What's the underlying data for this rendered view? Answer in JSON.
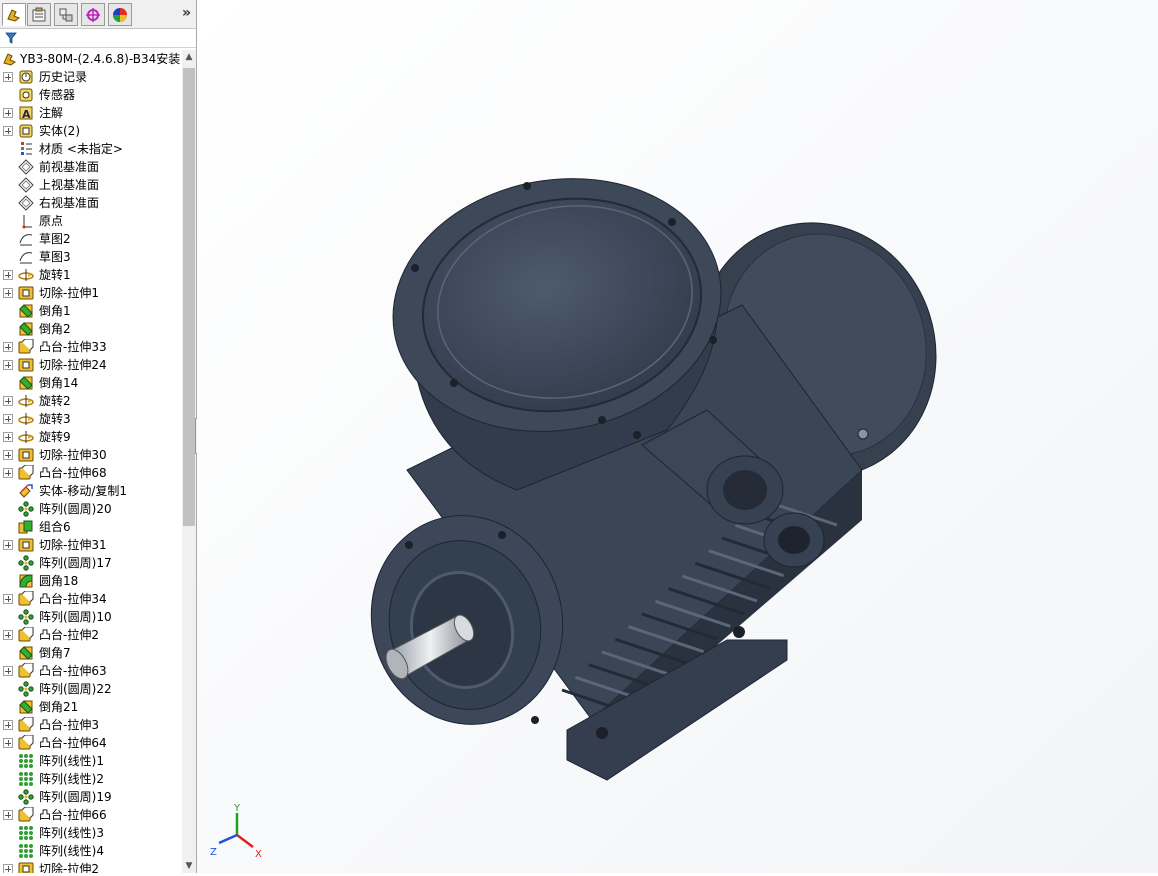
{
  "tabs": [
    {
      "name": "feature-manager",
      "active": true
    },
    {
      "name": "property-manager",
      "active": false
    },
    {
      "name": "configuration-manager",
      "active": false
    },
    {
      "name": "dimxpert-manager",
      "active": false
    },
    {
      "name": "display-manager",
      "active": false
    }
  ],
  "more_symbol": "»",
  "tree": {
    "root": "YB3-80M-(2.4.6.8)-B34安装",
    "items": [
      {
        "label": "历史记录",
        "icon": "history",
        "exp": true
      },
      {
        "label": "传感器",
        "icon": "sensor",
        "exp": false
      },
      {
        "label": "注解",
        "icon": "annotation",
        "exp": true
      },
      {
        "label": "实体(2)",
        "icon": "solid-bodies",
        "exp": true
      },
      {
        "label": "材质 <未指定>",
        "icon": "material",
        "exp": false
      },
      {
        "label": "前视基准面",
        "icon": "plane",
        "exp": false
      },
      {
        "label": "上视基准面",
        "icon": "plane",
        "exp": false
      },
      {
        "label": "右视基准面",
        "icon": "plane",
        "exp": false
      },
      {
        "label": "原点",
        "icon": "origin",
        "exp": false
      },
      {
        "label": "草图2",
        "icon": "sketch",
        "exp": false
      },
      {
        "label": "草图3",
        "icon": "sketch",
        "exp": false
      },
      {
        "label": "旋转1",
        "icon": "revolve",
        "exp": true
      },
      {
        "label": "切除-拉伸1",
        "icon": "cut-extrude",
        "exp": true
      },
      {
        "label": "倒角1",
        "icon": "chamfer",
        "exp": false
      },
      {
        "label": "倒角2",
        "icon": "chamfer",
        "exp": false
      },
      {
        "label": "凸台-拉伸33",
        "icon": "boss-extrude",
        "exp": true
      },
      {
        "label": "切除-拉伸24",
        "icon": "cut-extrude",
        "exp": true
      },
      {
        "label": "倒角14",
        "icon": "chamfer",
        "exp": false
      },
      {
        "label": "旋转2",
        "icon": "revolve",
        "exp": true
      },
      {
        "label": "旋转3",
        "icon": "revolve",
        "exp": true
      },
      {
        "label": "旋转9",
        "icon": "revolve",
        "exp": true
      },
      {
        "label": "切除-拉伸30",
        "icon": "cut-extrude",
        "exp": true
      },
      {
        "label": "凸台-拉伸68",
        "icon": "boss-extrude",
        "exp": true
      },
      {
        "label": "实体-移动/复制1",
        "icon": "move-copy",
        "exp": false
      },
      {
        "label": "阵列(圆周)20",
        "icon": "circular-pattern",
        "exp": false
      },
      {
        "label": "组合6",
        "icon": "combine",
        "exp": false
      },
      {
        "label": "切除-拉伸31",
        "icon": "cut-extrude",
        "exp": true
      },
      {
        "label": "阵列(圆周)17",
        "icon": "circular-pattern",
        "exp": false
      },
      {
        "label": "圆角18",
        "icon": "fillet",
        "exp": false
      },
      {
        "label": "凸台-拉伸34",
        "icon": "boss-extrude",
        "exp": true
      },
      {
        "label": "阵列(圆周)10",
        "icon": "circular-pattern",
        "exp": false
      },
      {
        "label": "凸台-拉伸2",
        "icon": "boss-extrude",
        "exp": true
      },
      {
        "label": "倒角7",
        "icon": "chamfer",
        "exp": false
      },
      {
        "label": "凸台-拉伸63",
        "icon": "boss-extrude",
        "exp": true
      },
      {
        "label": "阵列(圆周)22",
        "icon": "circular-pattern",
        "exp": false
      },
      {
        "label": "倒角21",
        "icon": "chamfer",
        "exp": false
      },
      {
        "label": "凸台-拉伸3",
        "icon": "boss-extrude",
        "exp": true
      },
      {
        "label": "凸台-拉伸64",
        "icon": "boss-extrude",
        "exp": true
      },
      {
        "label": "阵列(线性)1",
        "icon": "linear-pattern",
        "exp": false
      },
      {
        "label": "阵列(线性)2",
        "icon": "linear-pattern",
        "exp": false
      },
      {
        "label": "阵列(圆周)19",
        "icon": "circular-pattern",
        "exp": false
      },
      {
        "label": "凸台-拉伸66",
        "icon": "boss-extrude",
        "exp": true
      },
      {
        "label": "阵列(线性)3",
        "icon": "linear-pattern",
        "exp": false
      },
      {
        "label": "阵列(线性)4",
        "icon": "linear-pattern",
        "exp": false
      },
      {
        "label": "切除-拉伸2",
        "icon": "cut-extrude",
        "exp": true
      }
    ]
  },
  "triad": {
    "x": "X",
    "y": "Y",
    "z": "Z"
  },
  "colors": {
    "body": "#3f4a5c",
    "body_dark": "#2a323f",
    "body_light": "#5f6b80",
    "shaft": "#c8ccd2",
    "accent_x": "#e02020",
    "accent_y": "#20a020",
    "accent_z": "#2050e0"
  }
}
